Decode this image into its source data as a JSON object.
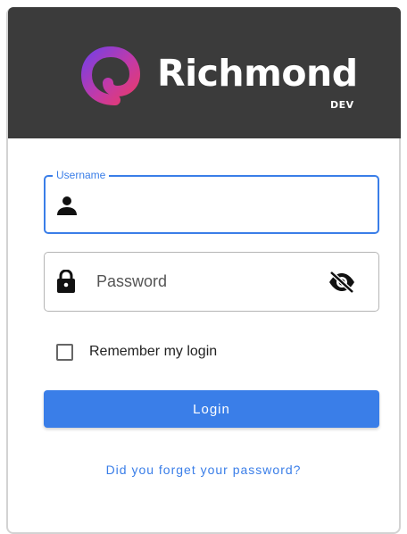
{
  "brand": {
    "name": "Richmond",
    "sub": "DEV",
    "logo_icon": "richmond-logo-icon"
  },
  "form": {
    "username": {
      "label": "Username",
      "value": "",
      "icon": "person-icon"
    },
    "password": {
      "placeholder": "Password",
      "value": "",
      "icon": "lock-icon",
      "toggle_icon": "eye-slash-icon"
    },
    "remember": {
      "label": "Remember my login",
      "checked": false
    },
    "login_label": "Login",
    "forgot_label": "Did you forget your password?"
  },
  "colors": {
    "accent": "#3a7ee8",
    "header_bg": "#3b3b3b"
  }
}
